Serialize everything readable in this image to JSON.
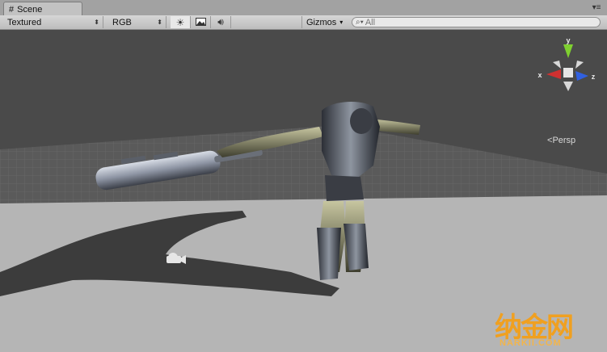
{
  "tab": {
    "icon": "grid-hash-icon",
    "label": "Scene"
  },
  "toolbar": {
    "render_mode": "Textured",
    "color_mode": "RGB",
    "gizmos_label": "Gizmos",
    "search_placeholder": "All",
    "buttons": [
      "lighting-toggle-icon",
      "skybox-toggle-icon",
      "audio-toggle-icon"
    ]
  },
  "viewport": {
    "projection_label": "Persp",
    "gizmo_axes": {
      "x": "x",
      "y": "y",
      "z": "z"
    },
    "colors": {
      "x_axis": "#d03030",
      "y_axis": "#7fd030",
      "z_axis": "#3060e0",
      "sky": "#4a4a4a",
      "ground": "#b5b5b5"
    }
  },
  "watermark": {
    "logo_text": "纳金网",
    "site": "NARKII.COM"
  }
}
